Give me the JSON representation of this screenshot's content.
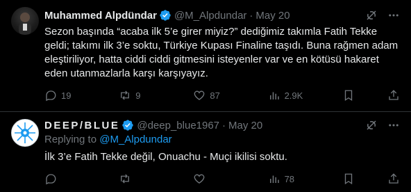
{
  "tweet1": {
    "name": "Muhammed Alpdündar",
    "handle": "@M_Alpdundar",
    "separator": "·",
    "date": "May 20",
    "text": "Sezon başında “acaba ilk 5’e girer miyiz?” dediğimiz takımla Fatih Tekke geldi; takımı ilk 3’e soktu, Türkiye Kupası Finaline taşıdı. Buna rağmen adam eleştiriliyor, hatta ciddi ciddi gitmesini isteyenler var ve en kötüsü hakaret eden utanmazlarla karşı karşıyayız.",
    "replies": "19",
    "retweets": "9",
    "likes": "87",
    "views": "2.9K"
  },
  "tweet2": {
    "name": "DEEP/BLUE",
    "handle": "@deep_blue1967",
    "separator": "·",
    "date": "May 20",
    "replying_prefix": "Replying to",
    "replying_handle": "@M_Alpdundar",
    "text": "İlk 3’e Fatih Tekke değil, Onuachu - Muçi ikilisi soktu.",
    "replies": "",
    "retweets": "",
    "likes": "",
    "views": "78"
  },
  "colors": {
    "background": "#000000",
    "text": "#e7e9ea",
    "muted": "#71767b",
    "accent": "#1d9bf0",
    "divider": "#2f3336"
  },
  "icons": [
    "verified-badge-icon",
    "grok-icon",
    "more-icon",
    "reply-icon",
    "retweet-icon",
    "like-icon",
    "views-icon",
    "bookmark-icon",
    "share-icon"
  ]
}
